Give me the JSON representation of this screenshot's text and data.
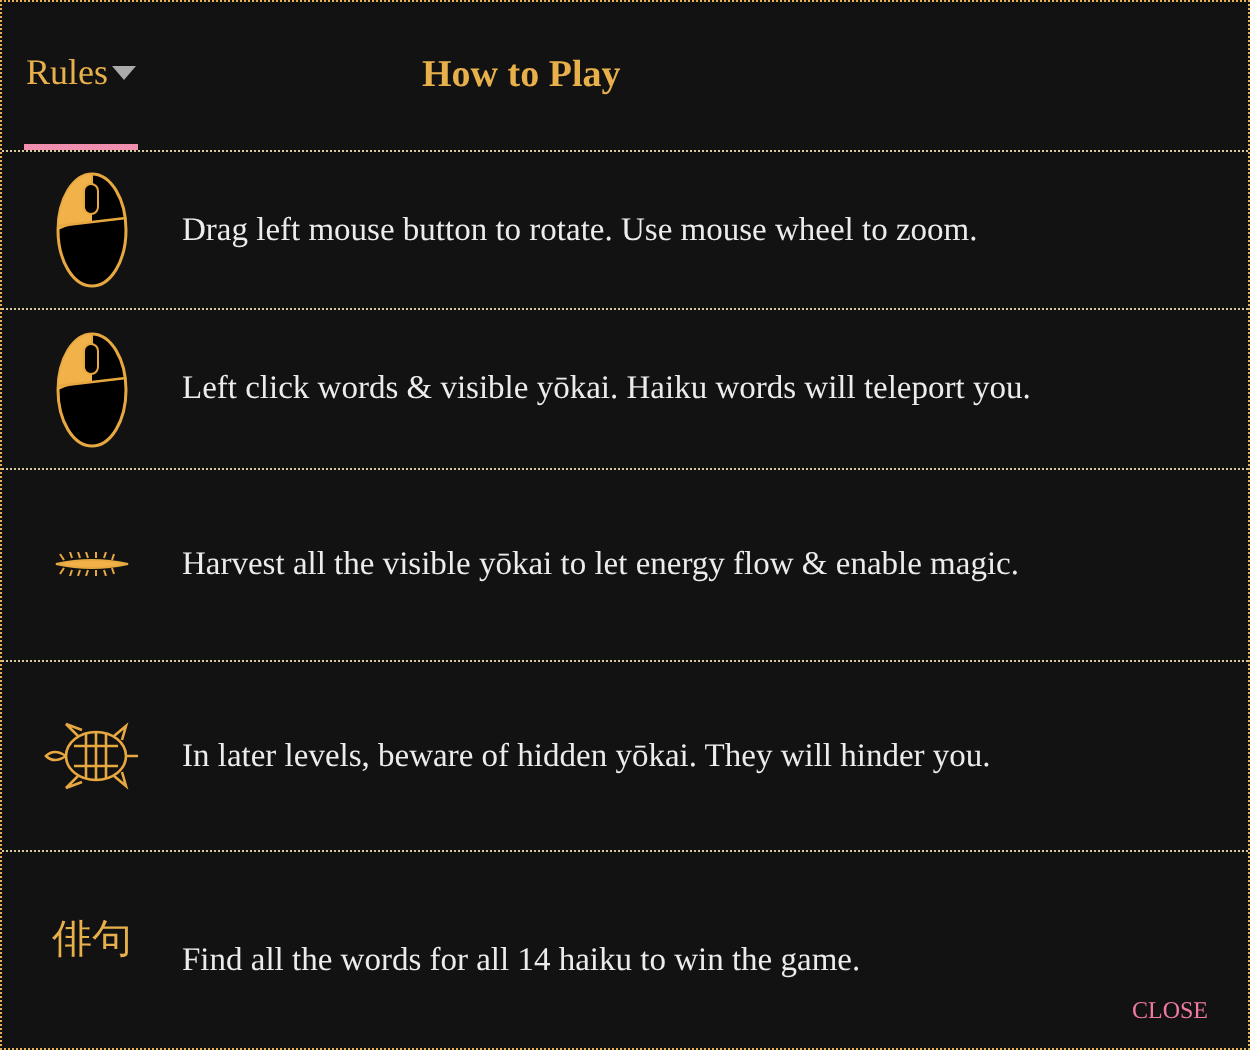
{
  "menu": {
    "label": "Rules",
    "selected": true
  },
  "title": "How to Play",
  "rows": [
    {
      "kind": "mouse",
      "text": "Drag left mouse button to rotate. Use mouse wheel to zoom."
    },
    {
      "kind": "mouse",
      "text": "Left click words & visible yōkai. Haiku words will teleport you."
    },
    {
      "kind": "centipede",
      "text": "Harvest all the visible yōkai to let energy flow & enable magic."
    },
    {
      "kind": "turtle",
      "text": "In later levels, beware of hidden yōkai. They will hinder you."
    },
    {
      "kind": "glyph",
      "glyph": "俳句",
      "text": "Find all the words for all 14 haiku to win the game."
    }
  ],
  "close": "CLOSE"
}
